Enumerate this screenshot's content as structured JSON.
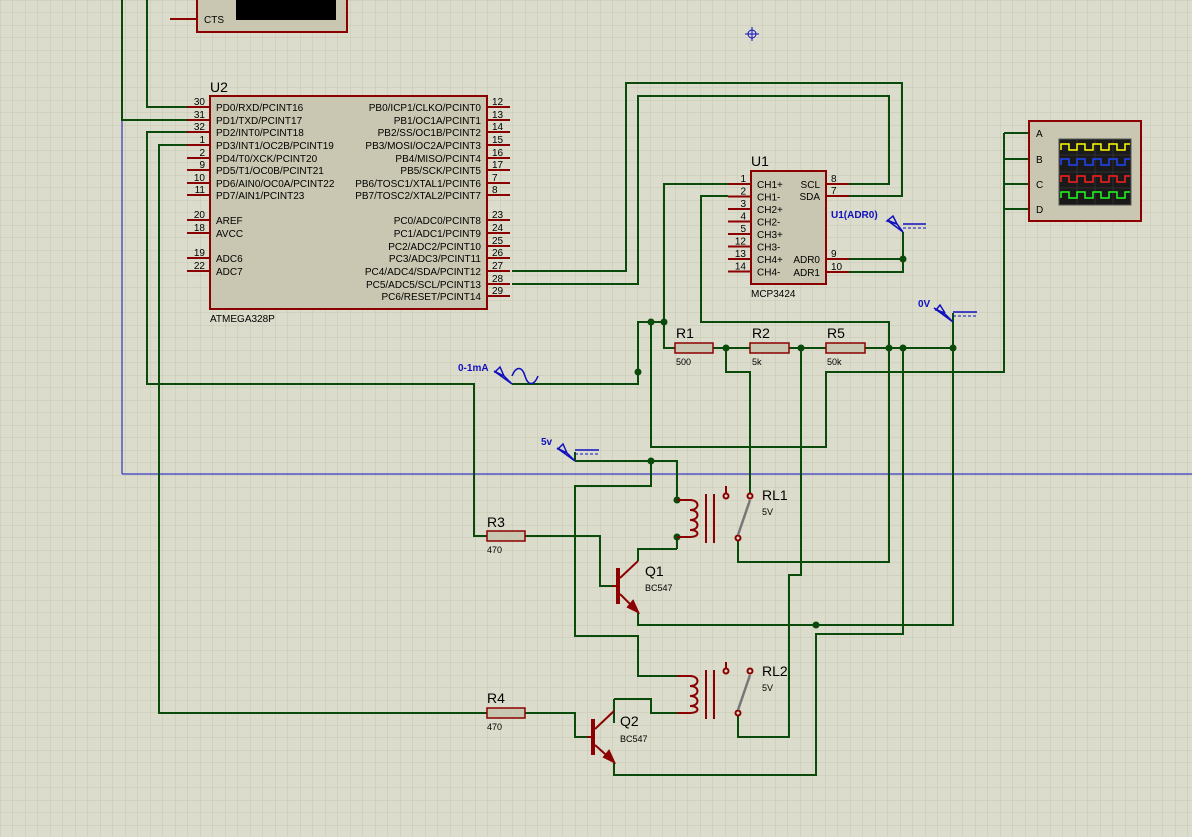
{
  "colors": {
    "background": "#dcdccc",
    "grid": "#c6c6b4",
    "wire": "#0a4a0a",
    "component": "#8b0000",
    "body_fill": "#c9c7b1",
    "label_blue": "#1010c0",
    "scope_trace_a": "#ffff00",
    "scope_trace_b": "#2244ff",
    "scope_trace_c": "#ff2020",
    "scope_trace_d": "#20ff20"
  },
  "top_component": {
    "pin_label": "CTS"
  },
  "u2": {
    "ref": "U2",
    "part": "ATMEGA328P",
    "left_pins": [
      {
        "num": "30",
        "name": "PD0/RXD/PCINT16"
      },
      {
        "num": "31",
        "name": "PD1/TXD/PCINT17"
      },
      {
        "num": "32",
        "name": "PD2/INT0/PCINT18"
      },
      {
        "num": "1",
        "name": "PD3/INT1/OC2B/PCINT19"
      },
      {
        "num": "2",
        "name": "PD4/T0/XCK/PCINT20"
      },
      {
        "num": "9",
        "name": "PD5/T1/OC0B/PCINT21"
      },
      {
        "num": "10",
        "name": "PD6/AIN0/OC0A/PCINT22"
      },
      {
        "num": "11",
        "name": "PD7/AIN1/PCINT23"
      },
      {
        "num": "20",
        "name": "AREF"
      },
      {
        "num": "18",
        "name": "AVCC"
      },
      {
        "num": "19",
        "name": "ADC6"
      },
      {
        "num": "22",
        "name": "ADC7"
      }
    ],
    "right_pins": [
      {
        "num": "12",
        "name": "PB0/ICP1/CLKO/PCINT0"
      },
      {
        "num": "13",
        "name": "PB1/OC1A/PCINT1"
      },
      {
        "num": "14",
        "name": "PB2/SS/OC1B/PCINT2"
      },
      {
        "num": "15",
        "name": "PB3/MOSI/OC2A/PCINT3"
      },
      {
        "num": "16",
        "name": "PB4/MISO/PCINT4"
      },
      {
        "num": "17",
        "name": "PB5/SCK/PCINT5"
      },
      {
        "num": "7",
        "name": "PB6/TOSC1/XTAL1/PCINT6"
      },
      {
        "num": "8",
        "name": "PB7/TOSC2/XTAL2/PCINT7"
      },
      {
        "num": "23",
        "name": "PC0/ADC0/PCINT8"
      },
      {
        "num": "24",
        "name": "PC1/ADC1/PCINT9"
      },
      {
        "num": "25",
        "name": "PC2/ADC2/PCINT10"
      },
      {
        "num": "26",
        "name": "PC3/ADC3/PCINT11"
      },
      {
        "num": "27",
        "name": "PC4/ADC4/SDA/PCINT12"
      },
      {
        "num": "28",
        "name": "PC5/ADC5/SCL/PCINT13"
      },
      {
        "num": "29",
        "name": "PC6/RESET/PCINT14"
      }
    ]
  },
  "u1": {
    "ref": "U1",
    "part": "MCP3424",
    "left_pins": [
      {
        "num": "1",
        "name": "CH1+"
      },
      {
        "num": "2",
        "name": "CH1-"
      },
      {
        "num": "3",
        "name": "CH2+"
      },
      {
        "num": "4",
        "name": "CH2-"
      },
      {
        "num": "5",
        "name": "CH3+"
      },
      {
        "num": "12",
        "name": "CH3-"
      },
      {
        "num": "13",
        "name": "CH4+"
      },
      {
        "num": "14",
        "name": "CH4-"
      }
    ],
    "right_pins": [
      {
        "num": "8",
        "name": "SCL"
      },
      {
        "num": "7",
        "name": "SDA"
      },
      {
        "num": "9",
        "name": "ADR0"
      },
      {
        "num": "10",
        "name": "ADR1"
      }
    ]
  },
  "resistors": [
    {
      "ref": "R1",
      "value": "500"
    },
    {
      "ref": "R2",
      "value": "5k"
    },
    {
      "ref": "R5",
      "value": "50k"
    },
    {
      "ref": "R3",
      "value": "470"
    },
    {
      "ref": "R4",
      "value": "470"
    }
  ],
  "relays": [
    {
      "ref": "RL1",
      "value": "5V"
    },
    {
      "ref": "RL2",
      "value": "5V"
    }
  ],
  "transistors": [
    {
      "ref": "Q1",
      "part": "BC547"
    },
    {
      "ref": "Q2",
      "part": "BC547"
    }
  ],
  "generators": [
    {
      "label": "U1(ADR0)"
    },
    {
      "label": "0V"
    },
    {
      "label": "0-1mA"
    },
    {
      "label": "5v"
    }
  ],
  "oscilloscope": {
    "channels": [
      "A",
      "B",
      "C",
      "D"
    ]
  }
}
